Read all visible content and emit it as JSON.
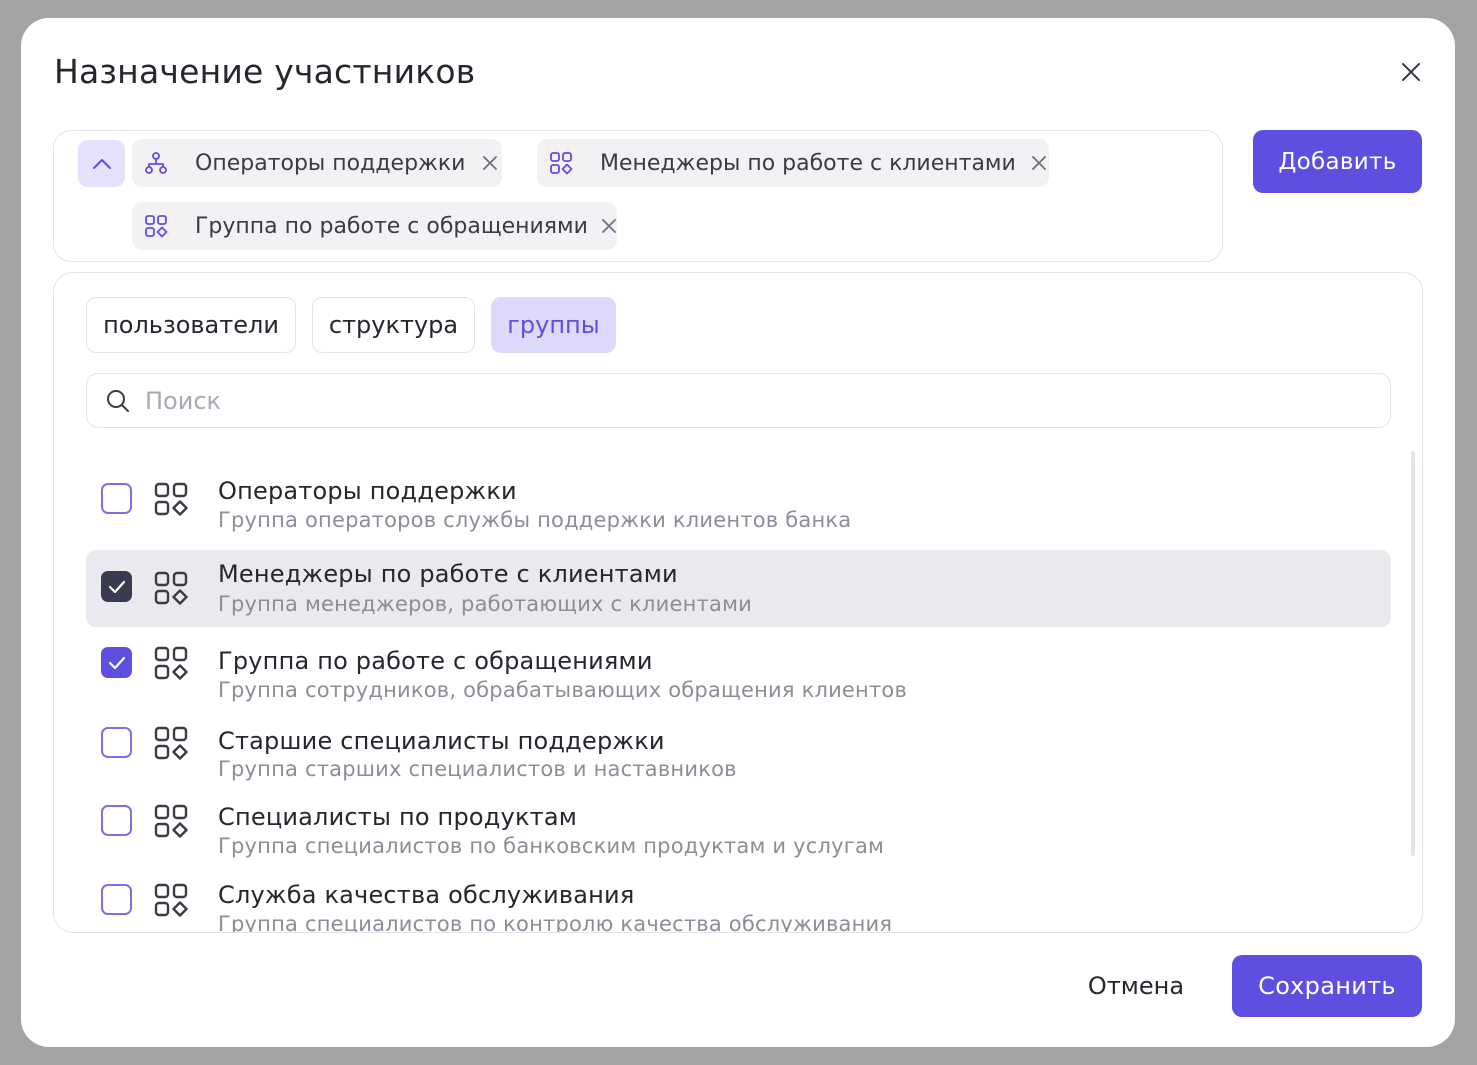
{
  "dialog": {
    "title": "Назначение участников",
    "close_icon": "close-icon"
  },
  "selected": {
    "chips": [
      {
        "label": "Операторы поддержки",
        "icon": "org-structure-icon"
      },
      {
        "label": "Менеджеры по работе с клиентами",
        "icon": "group-icon"
      },
      {
        "label": "Группа по работе с обращениями",
        "icon": "group-icon"
      }
    ],
    "collapse_icon": "chevron-up-icon",
    "add_label": "Добавить"
  },
  "tabs": [
    {
      "label": "пользователи",
      "active": false
    },
    {
      "label": "структура",
      "active": false
    },
    {
      "label": "группы",
      "active": true
    }
  ],
  "search": {
    "placeholder": "Поиск",
    "value": ""
  },
  "list": {
    "items": [
      {
        "title": "Операторы поддержки",
        "description": "Группа операторов службы поддержки клиентов банка",
        "checked": false
      },
      {
        "title": "Менеджеры по работе с клиентами",
        "description": "Группа менеджеров, работающих с клиентами",
        "checked": true,
        "highlighted": true
      },
      {
        "title": "Группа по работе с обращениями",
        "description": "Группа сотрудников, обрабатывающих обращения клиентов",
        "checked": true
      },
      {
        "title": "Старшие специалисты поддержки",
        "description": "Группа старших специалистов и наставников",
        "checked": false
      },
      {
        "title": "Специалисты по продуктам",
        "description": "Группа специалистов по банковским продуктам и услугам",
        "checked": false
      },
      {
        "title": "Служба качества обслуживания",
        "description": "Группа специалистов по контролю качества обслуживания",
        "checked": false
      }
    ]
  },
  "footer": {
    "cancel_label": "Отмена",
    "save_label": "Сохранить"
  },
  "colors": {
    "accent": "#5f4fe0",
    "accent_light": "#ddd9fb",
    "checkbox_dark": "#3a3a50",
    "row_highlight": "#e9e9ee"
  }
}
